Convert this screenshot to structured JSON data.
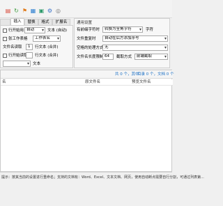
{
  "toolbar": {
    "icons": [
      {
        "name": "doc-red-icon",
        "color": "#d94a3a",
        "glyph": "▤"
      },
      {
        "name": "refresh-icon",
        "color": "#3a9a3a",
        "glyph": "↻"
      },
      {
        "name": "flag-icon",
        "color": "#e07a1a",
        "glyph": "⚑"
      },
      {
        "name": "apply-icon",
        "color": "#2c7fd0",
        "glyph": "▦"
      },
      {
        "name": "run-icon",
        "color": "#2c9a6a",
        "glyph": "▣"
      },
      {
        "name": "settings-icon",
        "color": "#3b73c8",
        "glyph": "⚙"
      },
      {
        "name": "help-icon",
        "color": "#777777",
        "glyph": "◎"
      }
    ]
  },
  "tabs": [
    "",
    "插入",
    "替换",
    "格式",
    "扩展名"
  ],
  "left": {
    "row1_label": "行开始用",
    "row1_value": "自动",
    "row1_suffix": "文本 (自动)",
    "row2_label": "张工作表格",
    "row2_value": "工作表名",
    "row3_label": "文件名读取",
    "row3_value": "1",
    "row3_suffix": "行文本 (合并)",
    "row4_label": "行开始读取",
    "row4_suffix": "行文本 (合并)",
    "row5_suffix": "文本"
  },
  "right": {
    "section": "通用设置",
    "r1_label": "有前缀字符时",
    "r1_value": "转换为全角字符",
    "r1_button": "字符",
    "r2_label": "文件重复时",
    "r2_value": "自动在后方添加序号",
    "r3_label": "空格的处理方式",
    "r3_value": "无",
    "r4_label": "文件名长度限制",
    "r4_value": "64",
    "r4_mode_label": "截取方式",
    "r4_mode_value": "前端截取"
  },
  "list": {
    "summary_prefix": "共 0 个，其中：",
    "summary_detail": "目录 0 个，文档 0 个",
    "col_name": "名",
    "col_original": "原文件名",
    "col_preview": "预览文件名"
  },
  "hint": {
    "text": "提示：按其当前的设置进行重命名；支持的文档有：Word、Excel、文本文档、网页，使用自动断点需要自行分割，可通过列表第..."
  }
}
